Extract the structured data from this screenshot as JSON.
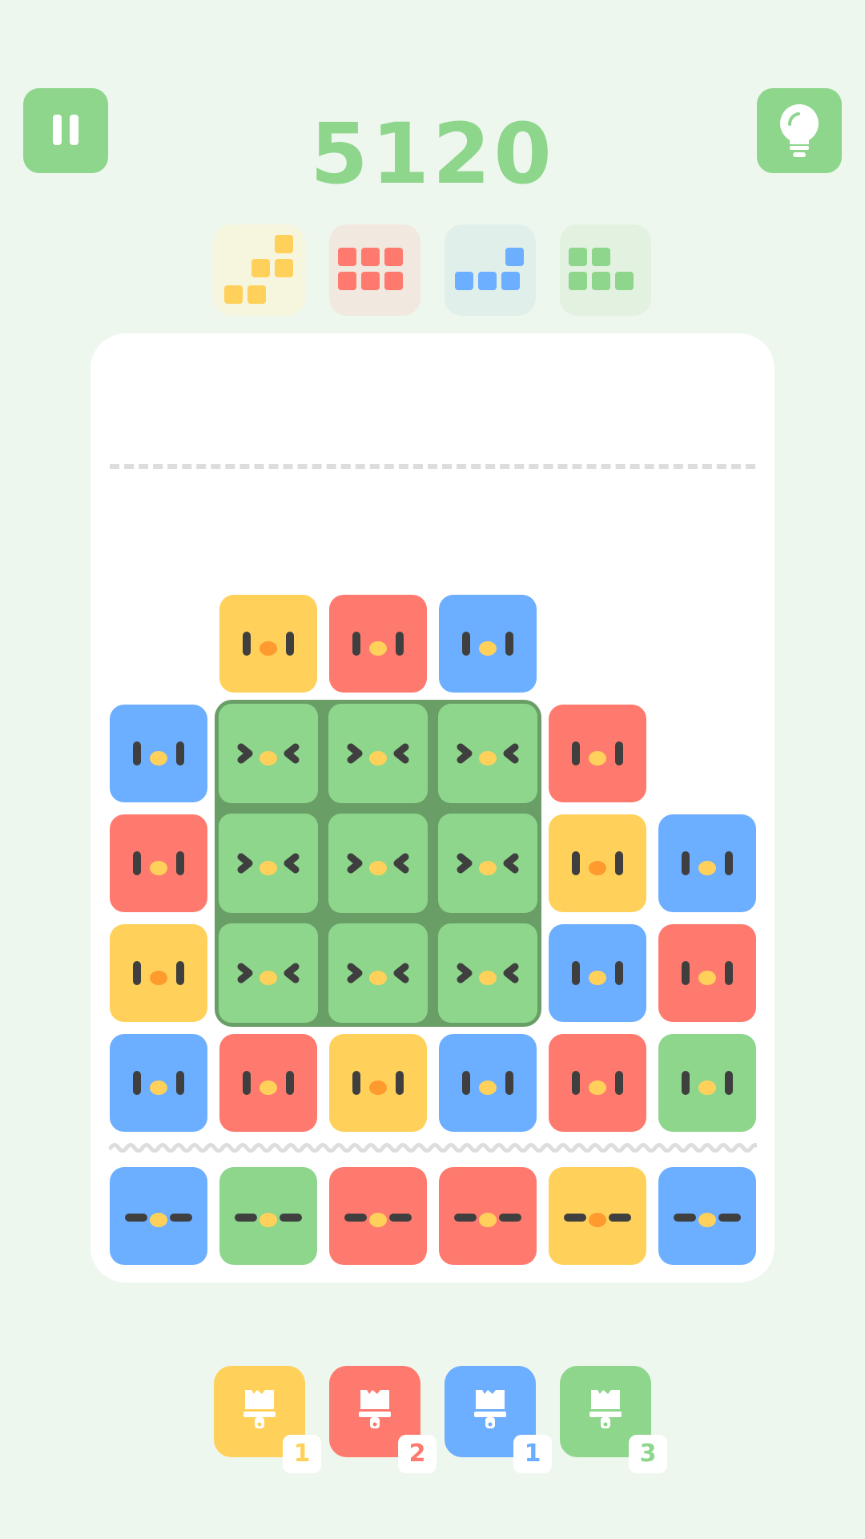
{
  "score": "5120",
  "top_buttons": {
    "pause": "pause-icon",
    "hint": "lightbulb-icon"
  },
  "goals": [
    {
      "color": "yellow",
      "shape": "staircase"
    },
    {
      "color": "red",
      "shape": "3x2 grid"
    },
    {
      "color": "blue",
      "shape": "L"
    },
    {
      "color": "green",
      "shape": "2+3 grid"
    }
  ],
  "colors": {
    "yellow": "#FFD15A",
    "red": "#FF7A6E",
    "blue": "#6CAEFF",
    "green": "#8DD68C",
    "green_outline": "#6A9E67",
    "background": "#EEF7EE"
  },
  "board": {
    "rows": [
      [
        null,
        "yellow",
        "red",
        "blue",
        null,
        null
      ],
      [
        "blue",
        "green",
        "green",
        "green",
        "red",
        null
      ],
      [
        "red",
        "green",
        "green",
        "green",
        "yellow",
        "blue"
      ],
      [
        "yellow",
        "green",
        "green",
        "green",
        "blue",
        "red"
      ],
      [
        "blue",
        "red",
        "yellow",
        "blue",
        "red",
        "green"
      ]
    ],
    "incoming_row": [
      "blue",
      "green",
      "red",
      "red",
      "yellow",
      "blue"
    ]
  },
  "tools": [
    {
      "color": "yellow",
      "icon": "paint-brush-icon",
      "count": "1"
    },
    {
      "color": "red",
      "icon": "paint-brush-icon",
      "count": "2"
    },
    {
      "color": "blue",
      "icon": "paint-brush-icon",
      "count": "1"
    },
    {
      "color": "green",
      "icon": "paint-brush-icon",
      "count": "3"
    }
  ]
}
